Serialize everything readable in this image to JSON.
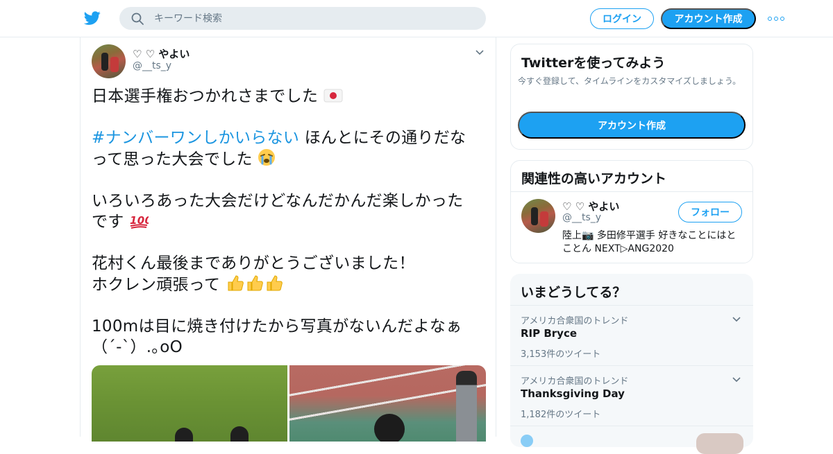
{
  "header": {
    "search_placeholder": "キーワード検索",
    "login_label": "ログイン",
    "signup_label": "アカウント作成"
  },
  "tweet": {
    "user": {
      "name": "♡ ♡ やよい",
      "handle": "@__ts_y"
    },
    "lines": {
      "l1": "日本選手権おつかれさまでした",
      "hashtag": "#ナンバーワンしかいらない",
      "l2b": " ほんとにその通りだな",
      "l3": "って思った大会でした",
      "l4": "いろいろあった大会だけどなんだかんだ楽しかった",
      "l5": "です",
      "l6": "花村くん最後までありがとうございました！",
      "l7": "ホクレン頑張って",
      "l8": "100mは目に焼き付けたから写真がないんだよなぁ",
      "l9": "（´-`）.｡oO"
    },
    "emoji": {
      "flag": "jp-flag",
      "crying": "loudly-crying-face",
      "hundred": "hundred-points",
      "thumbs": "thumbs-up"
    }
  },
  "signup_card": {
    "title": "Twitterを使ってみよう",
    "description": "今すぐ登録して、タイムラインをカスタマイズしましょう。",
    "button": "アカウント作成"
  },
  "related": {
    "title": "関連性の高いアカウント",
    "account": {
      "name": "♡ ♡ やよい",
      "handle": "@__ts_y",
      "bio": "陸上📷 多田修平選手 好きなことにはとことん NEXT▷ANG2020",
      "follow_label": "フォロー"
    }
  },
  "trends": {
    "title": "いまどうしてる？",
    "items": [
      {
        "context": "アメリカ合衆国のトレンド",
        "name": "RIP Bryce",
        "count": "3,153件のツイート"
      },
      {
        "context": "アメリカ合衆国のトレンド",
        "name": "Thanksgiving Day",
        "count": "1,182件のツイート"
      }
    ]
  },
  "colors": {
    "brand": "#1da1f2",
    "hashtag": "#1b95e0",
    "secondary_text": "#657786",
    "border": "#e6ecf0"
  }
}
